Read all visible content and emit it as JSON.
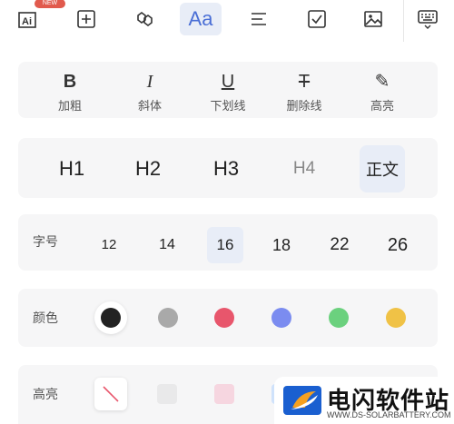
{
  "toolbar": {
    "badge": "NEW",
    "items": [
      "ai-text-icon",
      "plus-box-icon",
      "link-icon",
      "text-style-icon",
      "align-icon",
      "checkbox-icon",
      "image-icon",
      "keyboard-icon"
    ],
    "active_label": "Aa"
  },
  "styles": {
    "items": [
      {
        "glyph": "B",
        "label": "加粗"
      },
      {
        "glyph": "I",
        "label": "斜体"
      },
      {
        "glyph": "U",
        "label": "下划线"
      },
      {
        "glyph": "T",
        "label": "删除线"
      },
      {
        "glyph": "✎",
        "label": "高亮"
      }
    ]
  },
  "headings": {
    "items": [
      "H1",
      "H2",
      "H3",
      "H4",
      "正文"
    ],
    "selected": "正文"
  },
  "font_size": {
    "label": "字号",
    "items": [
      "12",
      "14",
      "16",
      "18",
      "22",
      "26"
    ],
    "selected": "16"
  },
  "color": {
    "label": "颜色",
    "swatches": [
      "#222222",
      "#a9a9a9",
      "#e8566c",
      "#7b8cf0",
      "#6bd17e",
      "#f0c246"
    ],
    "selected": "#222222"
  },
  "highlight": {
    "label": "高亮",
    "swatches": [
      "none",
      "#e9e9ea",
      "#f6d6e0",
      "#cfe2fb"
    ]
  },
  "watermark": {
    "title": "电闪软件站",
    "subtitle": "WWW.DS-SOLARBATTERY.COM"
  }
}
